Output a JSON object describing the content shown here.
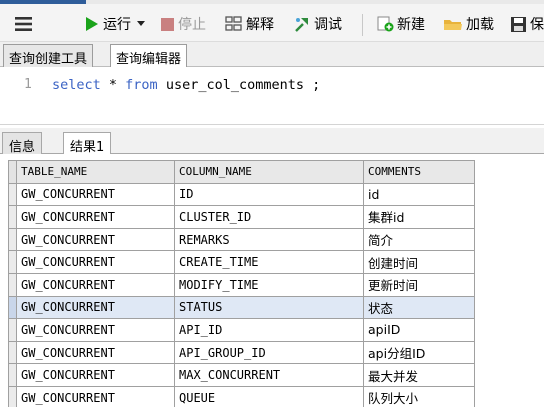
{
  "toolbar": {
    "run_label": "运行",
    "stop_label": "停止",
    "explain_label": "解释",
    "debug_label": "调试",
    "new_label": "新建",
    "load_label": "加载",
    "save_label": "保"
  },
  "query_tabs": [
    "查询创建工具",
    "查询编辑器"
  ],
  "editor": {
    "line_number": "1",
    "keyword_select": "select",
    "star": " * ",
    "keyword_from": "from",
    "rest": " user_col_comments ;"
  },
  "result_tabs": [
    "信息",
    "结果1"
  ],
  "result_table": {
    "columns": [
      "TABLE_NAME",
      "COLUMN_NAME",
      "COMMENTS"
    ],
    "rows": [
      [
        "GW_CONCURRENT",
        "ID",
        "id"
      ],
      [
        "GW_CONCURRENT",
        "CLUSTER_ID",
        "集群id"
      ],
      [
        "GW_CONCURRENT",
        "REMARKS",
        "简介"
      ],
      [
        "GW_CONCURRENT",
        "CREATE_TIME",
        "创建时间"
      ],
      [
        "GW_CONCURRENT",
        "MODIFY_TIME",
        "更新时间"
      ],
      [
        "GW_CONCURRENT",
        "STATUS",
        "状态"
      ],
      [
        "GW_CONCURRENT",
        "API_ID",
        "apiID"
      ],
      [
        "GW_CONCURRENT",
        "API_GROUP_ID",
        "api分组ID"
      ],
      [
        "GW_CONCURRENT",
        "MAX_CONCURRENT",
        "最大并发"
      ],
      [
        "GW_CONCURRENT",
        "QUEUE",
        "队列大小"
      ]
    ]
  },
  "colors": {
    "keyword": "#3b63c4",
    "run_green": "#1aa31a",
    "stop_red": "#c98080",
    "selected_row": "#dfe8f5"
  },
  "icons": [
    "menu-icon",
    "play-icon",
    "dropdown-arrow-icon",
    "stop-icon",
    "explain-icon",
    "debug-icon",
    "new-icon",
    "load-icon",
    "save-icon"
  ]
}
